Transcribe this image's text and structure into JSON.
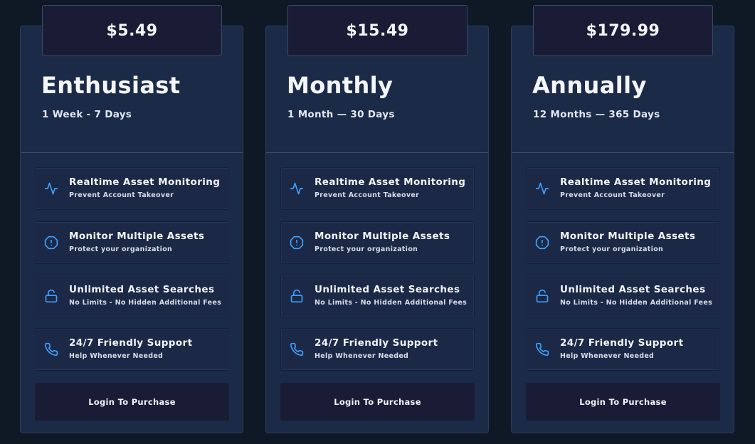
{
  "colors": {
    "page_background": "#0f1825",
    "card_background": "#1b2a47",
    "price_box_background": "#1a1c36",
    "icon_accent": "#3ea0ff",
    "button_background": "#1a1c36"
  },
  "plans": [
    {
      "price": "$5.49",
      "name": "Enthusiast",
      "duration": "1 Week - 7 Days",
      "button_label": "Login To Purchase"
    },
    {
      "price": "$15.49",
      "name": "Monthly",
      "duration": "1 Month — 30 Days",
      "button_label": "Login To Purchase"
    },
    {
      "price": "$179.99",
      "name": "Annually",
      "duration": "12 Months — 365 Days",
      "button_label": "Login To Purchase"
    }
  ],
  "features": [
    {
      "icon": "activity-icon",
      "title": "Realtime Asset Monitoring",
      "subtitle": "Prevent Account Takeover"
    },
    {
      "icon": "alert-octagon-icon",
      "title": "Monitor Multiple Assets",
      "subtitle": "Protect your organization"
    },
    {
      "icon": "unlock-icon",
      "title": "Unlimited Asset Searches",
      "subtitle": "No Limits - No Hidden Additional Fees"
    },
    {
      "icon": "phone-icon",
      "title": "24/7 Friendly Support",
      "subtitle": "Help Whenever Needed"
    }
  ]
}
